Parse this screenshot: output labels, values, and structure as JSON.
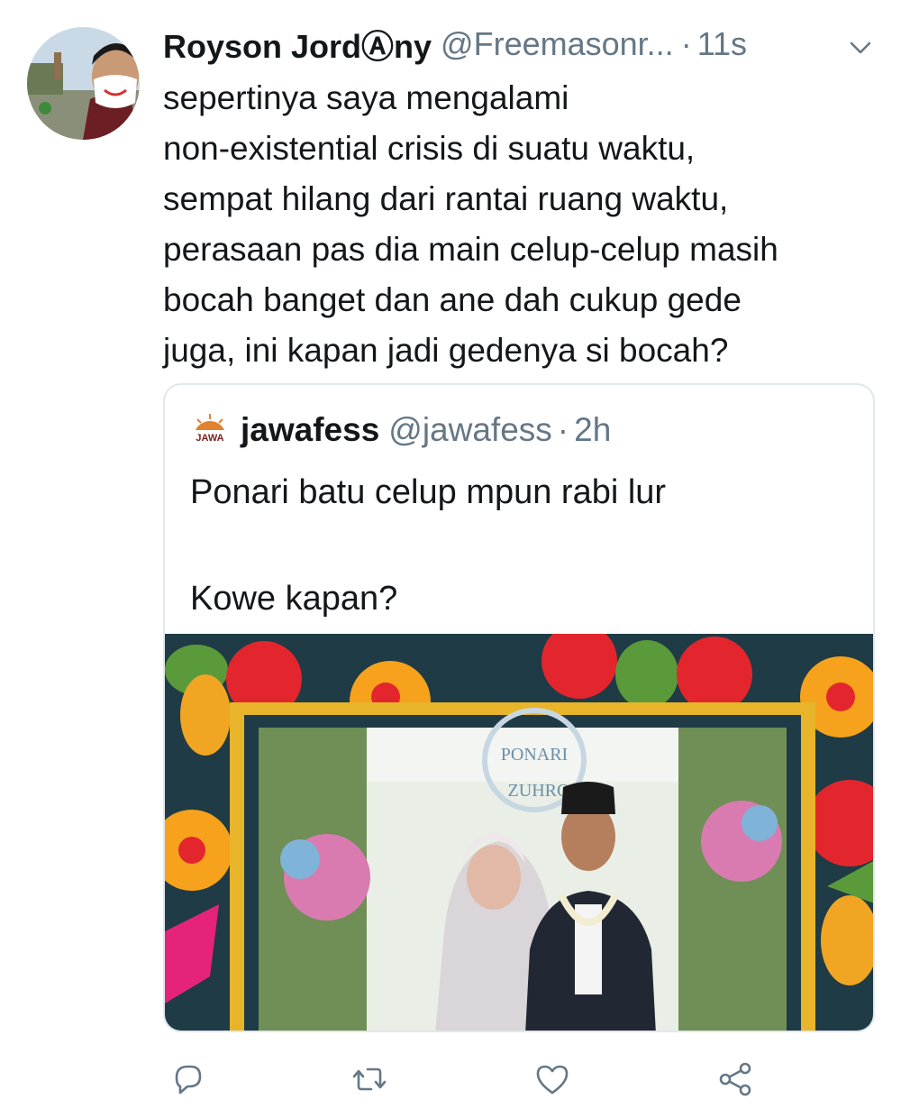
{
  "tweet": {
    "author_name": "Royson JordⒶny",
    "author_handle": "@Freemasonr...",
    "separator": "·",
    "time": "11s",
    "text": "sepertinya saya mengalami\nnon-existential crisis di suatu waktu,\nsempat hilang dari rantai ruang waktu,\nperasaan pas dia main celup-celup masih\nbocah banget dan ane dah cukup gede\njuga, ini kapan jadi gedenya si bocah?",
    "avatar_icon": "profile-photo-masked-man"
  },
  "quote": {
    "author_name": "jawafess",
    "author_handle": "@jawafess",
    "separator": "·",
    "time": "2h",
    "text": "Ponari batu celup mpun rabi lur\n\nKowe kapan?",
    "logo_text": "JAWA",
    "image_sign_line1": "PONARI",
    "image_sign_line2": "ZUHRO"
  },
  "actions": {
    "icons": [
      "reply-icon",
      "retweet-icon",
      "like-icon",
      "share-icon"
    ],
    "color": "#657786"
  },
  "colors": {
    "text": "#14171a",
    "secondary": "#657786",
    "border": "#e1e8ed",
    "frame_bg": "#1f3b45",
    "frame_gold": "#e8b52a"
  }
}
